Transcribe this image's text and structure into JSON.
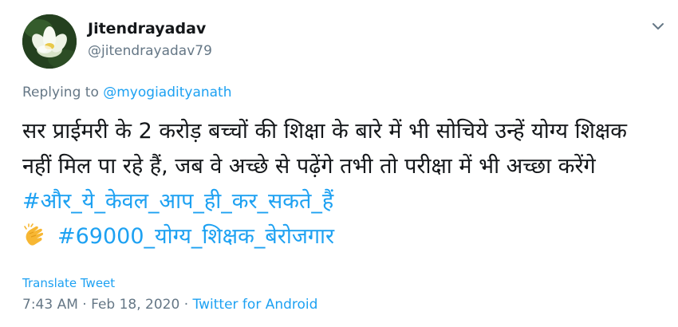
{
  "tweet": {
    "display_name": "Jitendrayadav",
    "handle": "@jitendrayadav79",
    "replying_prefix": "Replying to",
    "replying_mention": "@myogiadityanath",
    "text_line1": "सर प्राईमरी के 2 करोड़ बच्चों की शिक्षा के बारे में भी सोचिये  उन्हें योग्य शिक्षक नहीं मिल पा रहे हैं, जब वे अच्छे से पढ़ेंगे तभी तो परीक्षा में भी अच्छा करेंगे ",
    "hashtag1": "#और_ये_केवल_आप_ही_कर_सकते_हैं",
    "hashtag2": "#69000_योग्य_शिक्षक_बेरोजगार",
    "translate_label": "Translate Tweet",
    "time": "7:43 AM",
    "separator1": " · ",
    "date": "Feb 18, 2020",
    "separator2": " · ",
    "source": "Twitter for Android"
  },
  "icons": {
    "avatar": "lotus-flower-avatar",
    "menu": "chevron-down-icon",
    "emoji": "clapping-hands-emoji"
  },
  "colors": {
    "link": "#1da1f2",
    "secondary_text": "#657786",
    "primary_text": "#14171a"
  }
}
